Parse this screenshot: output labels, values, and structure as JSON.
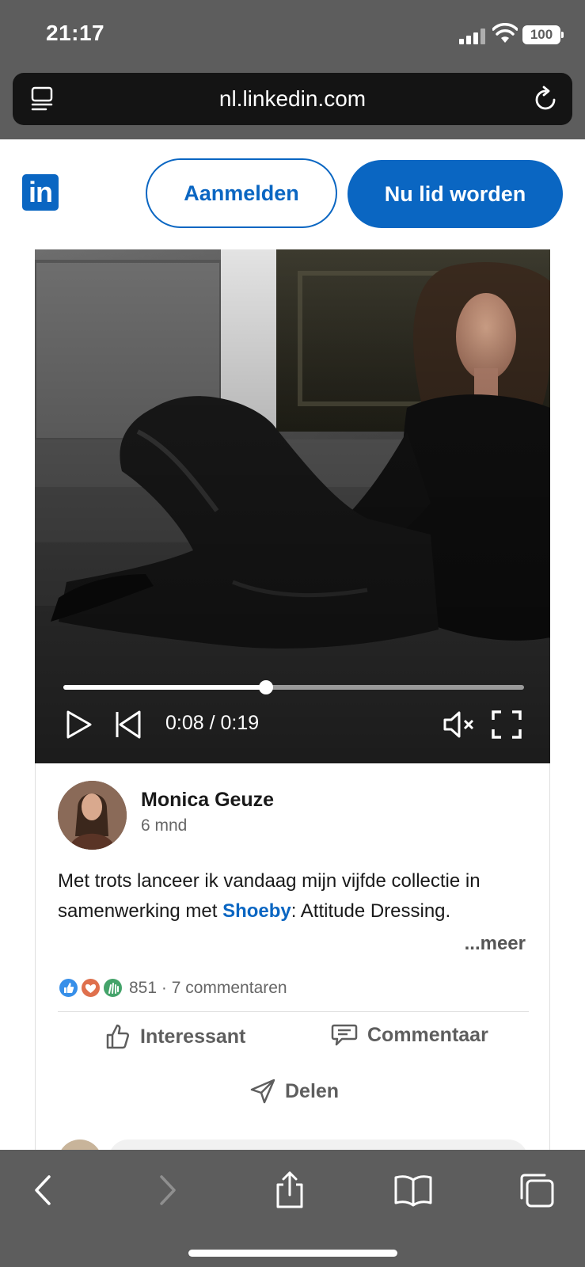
{
  "status_bar": {
    "time": "21:17",
    "battery": "100"
  },
  "browser": {
    "url": "nl.linkedin.com"
  },
  "header": {
    "logo_text": "in",
    "signin_label": "Aanmelden",
    "join_label": "Nu lid worden"
  },
  "video": {
    "time_display": "0:08 / 0:19",
    "progress": 0.44
  },
  "post": {
    "author": "Monica Geuze",
    "time_ago": "6 mnd",
    "text_before": "Met trots lanceer ik vandaag mijn vijfde collectie in samenwerking met ",
    "mention": "Shoeby",
    "text_after": ": Attitude Dressing.",
    "more_label": "...meer",
    "reactions_summary": "851 · 7 commentaren",
    "actions": {
      "like": "Interessant",
      "comment": "Commentaar",
      "share": "Delen"
    }
  },
  "colors": {
    "brand": "#0a66c2",
    "chrome": "#5d5d5d"
  }
}
